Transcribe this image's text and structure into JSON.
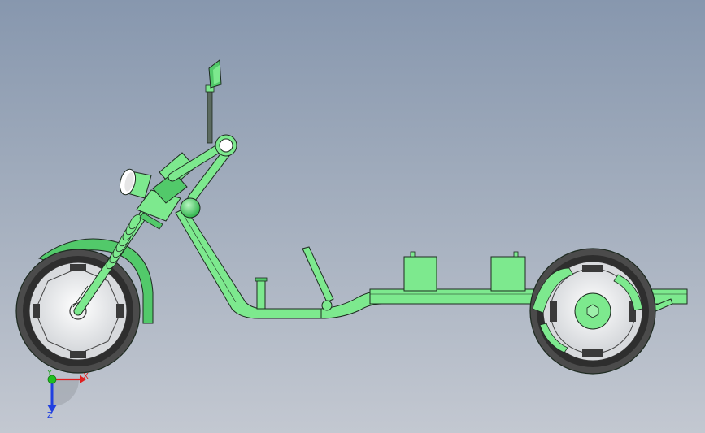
{
  "viewport": {
    "colors": {
      "part_fill": "#7de98e",
      "part_dark": "#2fb24a",
      "outline": "#1d2a20",
      "tire": "#4a4a4a",
      "rim": "#d7d9dc",
      "hub": "#f5f5f5"
    }
  },
  "triad": {
    "x_label": "X",
    "y_label": "Y",
    "z_label": "Z",
    "x_color": "#e02020",
    "y_color": "#20c020",
    "z_color": "#2040e0"
  }
}
